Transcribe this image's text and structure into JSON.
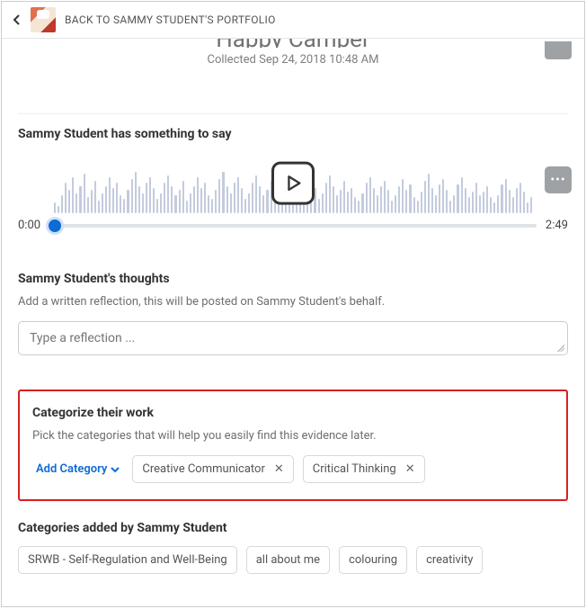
{
  "header": {
    "back_label": "BACK TO SAMMY STUDENT'S PORTFOLIO"
  },
  "title": {
    "text": "Happy Camper",
    "collected_prefix": "Collected",
    "collected_date": "Sep 24, 2018 10:48 AM"
  },
  "audio": {
    "section_title": "Sammy Student has something to say",
    "current_time": "0:00",
    "total_time": "2:49",
    "more_label": "•••"
  },
  "thoughts": {
    "title": "Sammy Student's thoughts",
    "hint": "Add a written reflection, this will be posted on Sammy Student's behalf.",
    "placeholder": "Type a reflection ..."
  },
  "categorize": {
    "title": "Categorize their work",
    "hint": "Pick the categories that will help you easily find this evidence later.",
    "add_label": "Add Category",
    "chips": [
      "Creative Communicator",
      "Critical Thinking"
    ]
  },
  "student_categories": {
    "title": "Categories added by Sammy Student",
    "chips": [
      "SRWB - Self-Regulation and Well-Being",
      "all about me",
      "colouring",
      "creativity"
    ]
  }
}
